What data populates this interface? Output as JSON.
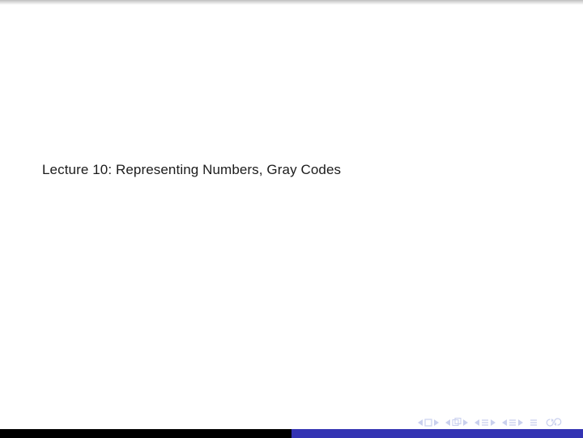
{
  "slide": {
    "title": "Lecture 10: Representing Numbers, Gray Codes"
  },
  "nav": {
    "first_group": "first-slide",
    "subdoc_group": "sub-doc-nav",
    "prev_section": "prev-section",
    "next_section": "next-section",
    "end": "end-slide",
    "refresh": "refresh"
  },
  "progress": {
    "done_fraction": 0.5
  }
}
